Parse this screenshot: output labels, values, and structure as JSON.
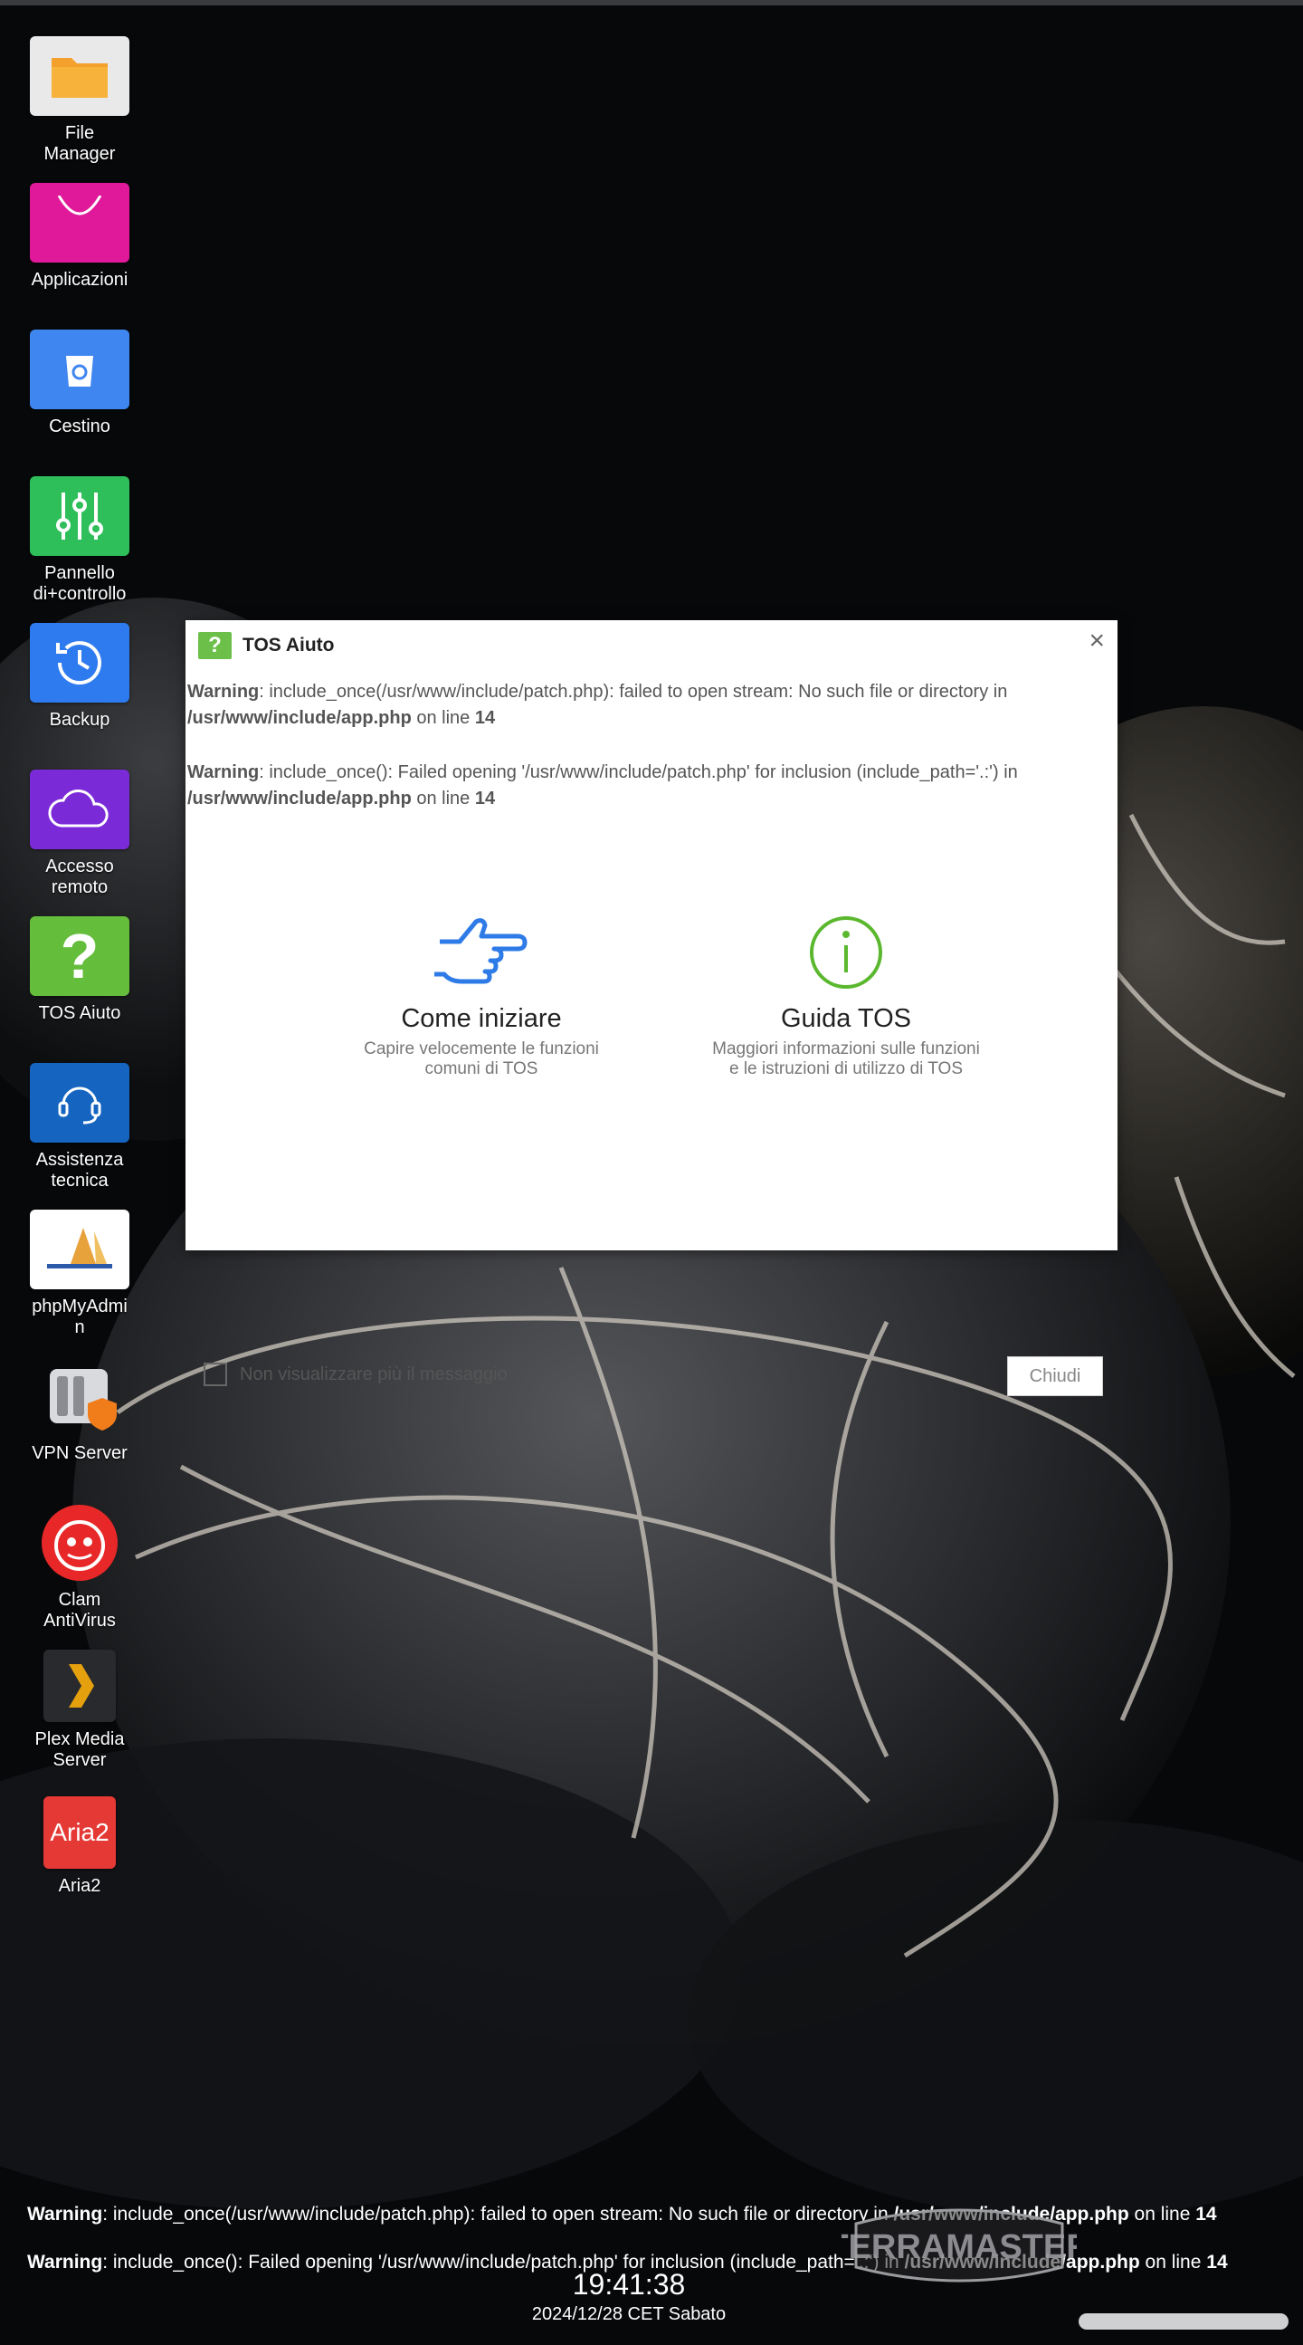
{
  "desktop": {
    "icons": [
      {
        "label": "File\nManager",
        "icon": "folder-icon",
        "color": "#e9e9e9"
      },
      {
        "label": "Applicazioni",
        "icon": "shopping-bag-icon",
        "color": "#e0199a"
      },
      {
        "label": "Cestino",
        "icon": "recycle-bin-icon",
        "color": "#3f86f0"
      },
      {
        "label": "Pannello\ndi+controllo",
        "icon": "sliders-icon",
        "color": "#2fbf5a"
      },
      {
        "label": "Backup",
        "icon": "clock-history-icon",
        "color": "#2e7bef"
      },
      {
        "label": "Accesso\nremoto",
        "icon": "cloud-icon",
        "color": "#7b2ad8"
      },
      {
        "label": "TOS Aiuto",
        "icon": "question-icon",
        "color": "#65bd3c"
      },
      {
        "label": "Assistenza\ntecnica",
        "icon": "headset-icon",
        "color": "#1565c0"
      },
      {
        "label": "phpMyAdmi\nn",
        "icon": "phpmyadmin-icon",
        "color": "#ffffff"
      },
      {
        "label": "VPN Server",
        "icon": "vpn-shield-icon",
        "color": "transparent"
      },
      {
        "label": "Clam\nAntiVirus",
        "icon": "clam-antivirus-icon",
        "color": "transparent"
      },
      {
        "label": "Plex Media\nServer",
        "icon": "plex-icon",
        "color": "#282a2d"
      },
      {
        "label": "Aria2",
        "icon": "aria2-icon",
        "color": "#e53935"
      }
    ]
  },
  "dialog": {
    "title": "TOS Aiuto",
    "close": "×",
    "warnings": [
      {
        "label": "Warning",
        "text": ": include_once(/usr/www/include/patch.php): failed to open stream: No such file or directory in ",
        "file": "/usr/www/include/app.php",
        "online": " on line ",
        "line": "14"
      },
      {
        "label": "Warning",
        "text": ": include_once(): Failed opening '/usr/www/include/patch.php' for inclusion (include_path='.:') in ",
        "file": "/usr/www/include/app.php",
        "online": " on line ",
        "line": "14"
      }
    ],
    "options": [
      {
        "title": "Come iniziare",
        "desc": "Capire velocemente le funzioni\ncomuni di TOS",
        "icon": "pointing-hand-icon"
      },
      {
        "title": "Guida TOS",
        "desc": "Maggiori informazioni sulle funzioni\ne le istruzioni di utilizzo di TOS",
        "icon": "info-circle-icon"
      }
    ],
    "dont_show": "Non visualizzare più il messaggio",
    "close_button": "Chiudi"
  },
  "bottom_warnings": [
    {
      "label": "Warning",
      "text": ": include_once(/usr/www/include/patch.php): failed to open stream: No such file or directory in ",
      "file": "/usr/www/include/app.php",
      "online": " on line ",
      "line": "14"
    },
    {
      "label": "Warning",
      "text": ": include_once(): Failed opening '/usr/www/include/patch.php' for inclusion (include_path='.:') in ",
      "file": "/usr/www/include/app.php",
      "online": " on line ",
      "line": "14"
    }
  ],
  "logo": "TERRAMASTER",
  "clock": {
    "time": "19:41:38",
    "date": "2024/12/28 CET Sabato"
  }
}
